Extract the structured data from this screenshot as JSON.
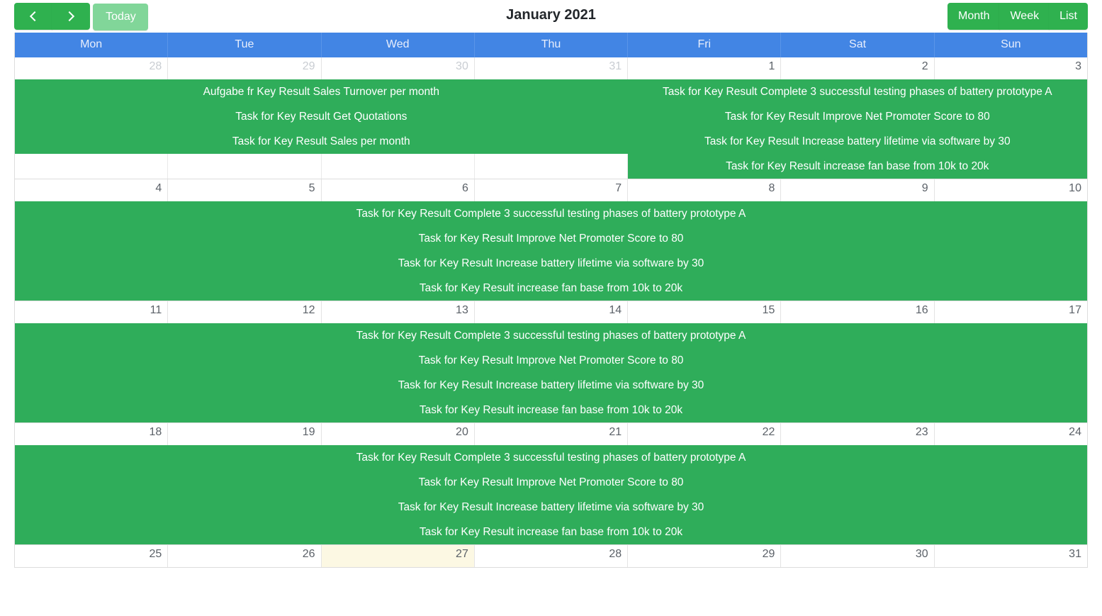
{
  "toolbar": {
    "prev_label": "‹",
    "prev_name": "previous",
    "next_label": "›",
    "today_label": "Today",
    "title": "January 2021",
    "views": [
      {
        "label": "Month",
        "active": true
      },
      {
        "label": "Week",
        "active": false
      },
      {
        "label": "List",
        "active": false
      }
    ]
  },
  "calendar": {
    "weekday_headers": [
      "Mon",
      "Tue",
      "Wed",
      "Thu",
      "Fri",
      "Sat",
      "Sun"
    ],
    "colors": {
      "header_blue": "#4285e4",
      "event_green": "#2fad5a",
      "button_green": "#2fb14f",
      "today_button_green": "#81d699",
      "today_cell": "#fcf8e3"
    },
    "weeks": [
      {
        "days": [
          {
            "num": "28",
            "other_month": true,
            "today": false
          },
          {
            "num": "29",
            "other_month": true,
            "today": false
          },
          {
            "num": "30",
            "other_month": true,
            "today": false
          },
          {
            "num": "31",
            "other_month": true,
            "today": false
          },
          {
            "num": "1",
            "other_month": false,
            "today": false
          },
          {
            "num": "2",
            "other_month": false,
            "today": false
          },
          {
            "num": "3",
            "other_month": false,
            "today": false
          }
        ],
        "rows": [
          [
            {
              "start": 0,
              "span": 4,
              "title": "Aufgabe fr Key Result Sales Turnover per month"
            },
            {
              "start": 4,
              "span": 3,
              "title": "Task for Key Result Complete 3 successful testing phases of battery prototype A"
            }
          ],
          [
            {
              "start": 0,
              "span": 4,
              "title": "Task for Key Result Get Quotations"
            },
            {
              "start": 4,
              "span": 3,
              "title": "Task for Key Result Improve Net Promoter Score to 80"
            }
          ],
          [
            {
              "start": 0,
              "span": 4,
              "title": "Task for Key Result Sales per month"
            },
            {
              "start": 4,
              "span": 3,
              "title": "Task for Key Result Increase battery lifetime via software by 30"
            }
          ],
          [
            {
              "start": 4,
              "span": 3,
              "title": "Task for Key Result increase fan base from 10k to 20k"
            }
          ]
        ]
      },
      {
        "days": [
          {
            "num": "4",
            "other_month": false,
            "today": false
          },
          {
            "num": "5",
            "other_month": false,
            "today": false
          },
          {
            "num": "6",
            "other_month": false,
            "today": false
          },
          {
            "num": "7",
            "other_month": false,
            "today": false
          },
          {
            "num": "8",
            "other_month": false,
            "today": false
          },
          {
            "num": "9",
            "other_month": false,
            "today": false
          },
          {
            "num": "10",
            "other_month": false,
            "today": false
          }
        ],
        "rows": [
          [
            {
              "start": 0,
              "span": 7,
              "title": "Task for Key Result Complete 3 successful testing phases of battery prototype A"
            }
          ],
          [
            {
              "start": 0,
              "span": 7,
              "title": "Task for Key Result Improve Net Promoter Score to 80"
            }
          ],
          [
            {
              "start": 0,
              "span": 7,
              "title": "Task for Key Result Increase battery lifetime via software by 30"
            }
          ],
          [
            {
              "start": 0,
              "span": 7,
              "title": "Task for Key Result increase fan base from 10k to 20k"
            }
          ]
        ]
      },
      {
        "days": [
          {
            "num": "11",
            "other_month": false,
            "today": false
          },
          {
            "num": "12",
            "other_month": false,
            "today": false
          },
          {
            "num": "13",
            "other_month": false,
            "today": false
          },
          {
            "num": "14",
            "other_month": false,
            "today": false
          },
          {
            "num": "15",
            "other_month": false,
            "today": false
          },
          {
            "num": "16",
            "other_month": false,
            "today": false
          },
          {
            "num": "17",
            "other_month": false,
            "today": false
          }
        ],
        "rows": [
          [
            {
              "start": 0,
              "span": 7,
              "title": "Task for Key Result Complete 3 successful testing phases of battery prototype A"
            }
          ],
          [
            {
              "start": 0,
              "span": 7,
              "title": "Task for Key Result Improve Net Promoter Score to 80"
            }
          ],
          [
            {
              "start": 0,
              "span": 7,
              "title": "Task for Key Result Increase battery lifetime via software by 30"
            }
          ],
          [
            {
              "start": 0,
              "span": 7,
              "title": "Task for Key Result increase fan base from 10k to 20k"
            }
          ]
        ]
      },
      {
        "days": [
          {
            "num": "18",
            "other_month": false,
            "today": false
          },
          {
            "num": "19",
            "other_month": false,
            "today": false
          },
          {
            "num": "20",
            "other_month": false,
            "today": false
          },
          {
            "num": "21",
            "other_month": false,
            "today": false
          },
          {
            "num": "22",
            "other_month": false,
            "today": false
          },
          {
            "num": "23",
            "other_month": false,
            "today": false
          },
          {
            "num": "24",
            "other_month": false,
            "today": false
          }
        ],
        "rows": [
          [
            {
              "start": 0,
              "span": 7,
              "title": "Task for Key Result Complete 3 successful testing phases of battery prototype A"
            }
          ],
          [
            {
              "start": 0,
              "span": 7,
              "title": "Task for Key Result Improve Net Promoter Score to 80"
            }
          ],
          [
            {
              "start": 0,
              "span": 7,
              "title": "Task for Key Result Increase battery lifetime via software by 30"
            }
          ],
          [
            {
              "start": 0,
              "span": 7,
              "title": "Task for Key Result increase fan base from 10k to 20k"
            }
          ]
        ]
      },
      {
        "days": [
          {
            "num": "25",
            "other_month": false,
            "today": false
          },
          {
            "num": "26",
            "other_month": false,
            "today": false
          },
          {
            "num": "27",
            "other_month": false,
            "today": true
          },
          {
            "num": "28",
            "other_month": false,
            "today": false
          },
          {
            "num": "29",
            "other_month": false,
            "today": false
          },
          {
            "num": "30",
            "other_month": false,
            "today": false
          },
          {
            "num": "31",
            "other_month": false,
            "today": false
          }
        ],
        "rows": []
      }
    ]
  }
}
